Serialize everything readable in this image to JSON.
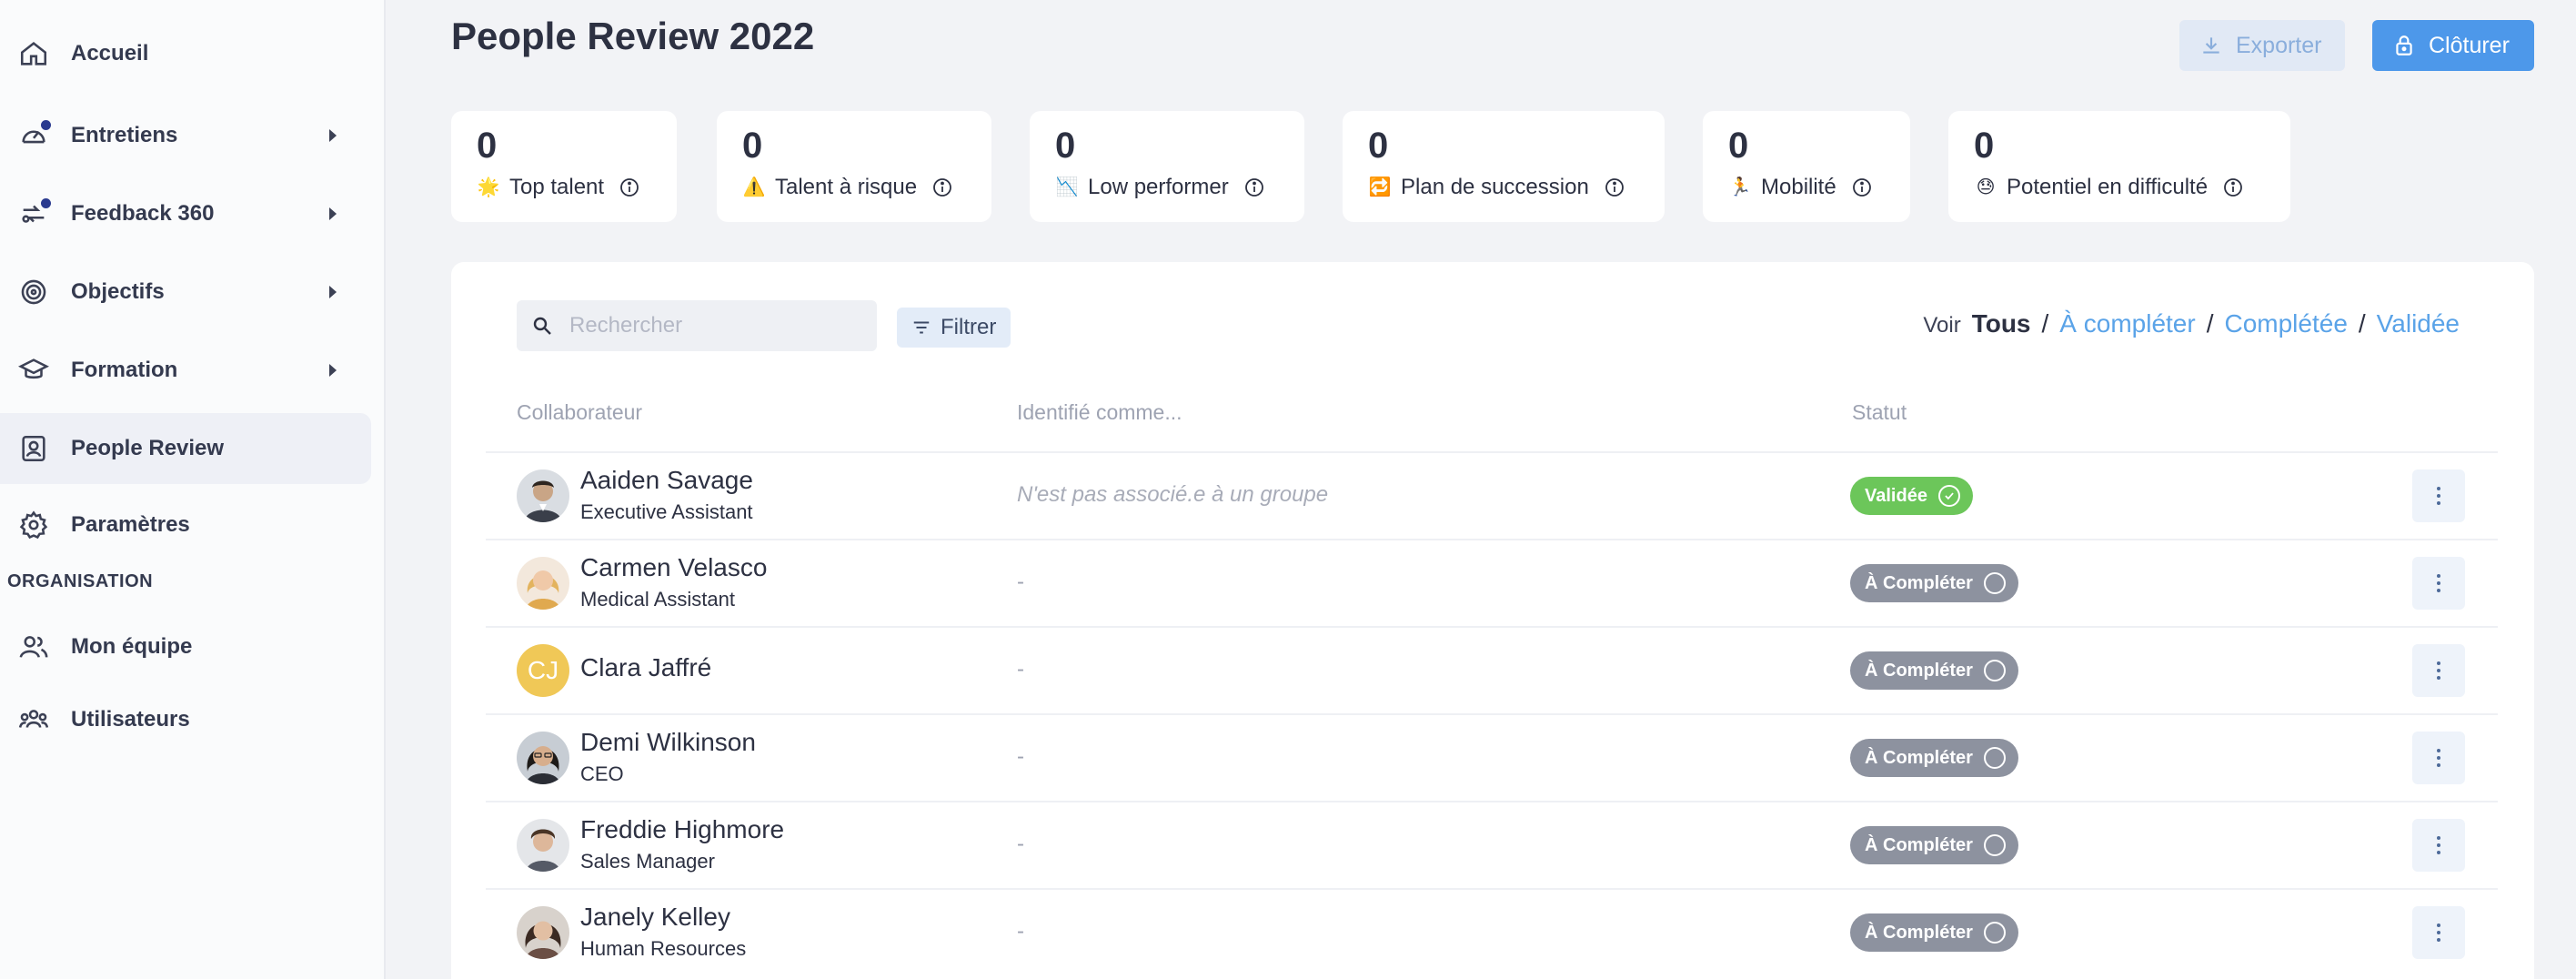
{
  "sidebar": {
    "items": [
      {
        "label": "Accueil",
        "icon": "home-icon"
      },
      {
        "label": "Entretiens",
        "icon": "gauge-icon"
      },
      {
        "label": "Feedback 360",
        "icon": "feedback-icon"
      },
      {
        "label": "Objectifs",
        "icon": "target-icon"
      },
      {
        "label": "Formation",
        "icon": "graduation-cap-icon"
      },
      {
        "label": "People Review",
        "icon": "id-badge-icon"
      },
      {
        "label": "Paramètres",
        "icon": "gear-icon"
      }
    ],
    "section_title": "ORGANISATION",
    "org_items": [
      {
        "label": "Mon équipe",
        "icon": "team-icon"
      },
      {
        "label": "Utilisateurs",
        "icon": "users-icon"
      }
    ]
  },
  "header": {
    "title": "People Review 2022",
    "export_label": "Exporter",
    "close_label": "Clôturer"
  },
  "stats": [
    {
      "value": "0",
      "label": "Top talent",
      "emoji": "🌟"
    },
    {
      "value": "0",
      "label": "Talent à risque",
      "emoji": "⚠️"
    },
    {
      "value": "0",
      "label": "Low performer",
      "emoji": "📉"
    },
    {
      "value": "0",
      "label": "Plan de succession",
      "emoji": "🔁"
    },
    {
      "value": "0",
      "label": "Mobilité",
      "emoji": "🏃"
    },
    {
      "value": "0",
      "label": "Potentiel en difficulté",
      "emoji": "😓"
    }
  ],
  "toolbar": {
    "search_placeholder": "Rechercher",
    "filter_label": "Filtrer"
  },
  "view": {
    "label": "Voir",
    "current": "Tous",
    "options": [
      "À compléter",
      "Complétée",
      "Validée"
    ],
    "separator": "/"
  },
  "table": {
    "columns": [
      "Collaborateur",
      "Identifié comme...",
      "Statut"
    ],
    "rows": [
      {
        "name": "Aaiden Savage",
        "role": "Executive Assistant",
        "group": "N'est pas associé.e à un groupe",
        "status": "Validée",
        "avatar_initials": ""
      },
      {
        "name": "Carmen Velasco",
        "role": "Medical Assistant",
        "group": "-",
        "status": "À Compléter",
        "avatar_initials": ""
      },
      {
        "name": "Clara Jaffré",
        "role": "",
        "group": "-",
        "status": "À Compléter",
        "avatar_initials": "CJ"
      },
      {
        "name": "Demi Wilkinson",
        "role": "CEO",
        "group": "-",
        "status": "À Compléter",
        "avatar_initials": ""
      },
      {
        "name": "Freddie Highmore",
        "role": "Sales Manager",
        "group": "-",
        "status": "À Compléter",
        "avatar_initials": ""
      },
      {
        "name": "Janely Kelley",
        "role": "Human Resources",
        "group": "-",
        "status": "À Compléter",
        "avatar_initials": ""
      }
    ]
  },
  "colors": {
    "accent": "#4d98ea",
    "validated": "#6cc65a",
    "pending": "#8d929f",
    "link": "#5aa3e8"
  }
}
